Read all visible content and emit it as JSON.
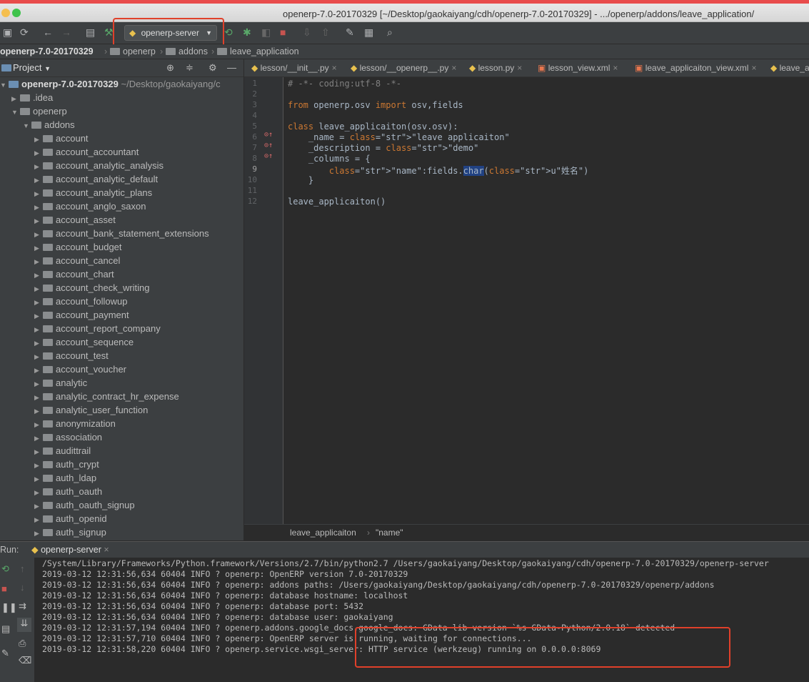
{
  "window": {
    "title": "openerp-7.0-20170329 [~/Desktop/gaokaiyang/cdh/openerp-7.0-20170329] - .../openerp/addons/leave_application/"
  },
  "toolbar": {
    "run_config": "openerp-server"
  },
  "breadcrumbs": [
    "openerp-7.0-20170329",
    "openerp",
    "addons",
    "leave_application"
  ],
  "project": {
    "title": "Project",
    "root": {
      "name": "openerp-7.0-20170329",
      "path": "~/Desktop/gaokaiyang/c"
    },
    "items": [
      {
        "label": ".idea",
        "level": 1,
        "open": false
      },
      {
        "label": "openerp",
        "level": 1,
        "open": true
      },
      {
        "label": "addons",
        "level": 2,
        "open": true
      },
      {
        "label": "account",
        "level": 3
      },
      {
        "label": "account_accountant",
        "level": 3
      },
      {
        "label": "account_analytic_analysis",
        "level": 3
      },
      {
        "label": "account_analytic_default",
        "level": 3
      },
      {
        "label": "account_analytic_plans",
        "level": 3
      },
      {
        "label": "account_anglo_saxon",
        "level": 3
      },
      {
        "label": "account_asset",
        "level": 3
      },
      {
        "label": "account_bank_statement_extensions",
        "level": 3
      },
      {
        "label": "account_budget",
        "level": 3
      },
      {
        "label": "account_cancel",
        "level": 3
      },
      {
        "label": "account_chart",
        "level": 3
      },
      {
        "label": "account_check_writing",
        "level": 3
      },
      {
        "label": "account_followup",
        "level": 3
      },
      {
        "label": "account_payment",
        "level": 3
      },
      {
        "label": "account_report_company",
        "level": 3
      },
      {
        "label": "account_sequence",
        "level": 3
      },
      {
        "label": "account_test",
        "level": 3
      },
      {
        "label": "account_voucher",
        "level": 3
      },
      {
        "label": "analytic",
        "level": 3
      },
      {
        "label": "analytic_contract_hr_expense",
        "level": 3
      },
      {
        "label": "analytic_user_function",
        "level": 3
      },
      {
        "label": "anonymization",
        "level": 3
      },
      {
        "label": "association",
        "level": 3
      },
      {
        "label": "audittrail",
        "level": 3
      },
      {
        "label": "auth_crypt",
        "level": 3
      },
      {
        "label": "auth_ldap",
        "level": 3
      },
      {
        "label": "auth_oauth",
        "level": 3
      },
      {
        "label": "auth_oauth_signup",
        "level": 3
      },
      {
        "label": "auth_openid",
        "level": 3
      },
      {
        "label": "auth_signup",
        "level": 3
      }
    ]
  },
  "tabs": [
    "lesson/__init__.py",
    "lesson/__openerp__.py",
    "lesson.py",
    "lesson_view.xml",
    "leave_applicaiton_view.xml",
    "leave_a"
  ],
  "editor": {
    "lines": [
      "# -*- coding:utf-8 -*-",
      "",
      "from openerp.osv import osv,fields",
      "",
      "class leave_applicaiton(osv.osv):",
      "    _name = \"leave applicaiton\"",
      "    _description = \"demo\"",
      "    _columns = {",
      "        \"name\":fields.char(u\"姓名\")",
      "    }",
      "",
      "leave_applicaiton()"
    ],
    "breadcrumb": [
      "leave_applicaiton",
      "\"name\""
    ]
  },
  "run": {
    "label": "Run:",
    "tab": "openerp-server",
    "console": [
      "/System/Library/Frameworks/Python.framework/Versions/2.7/bin/python2.7 /Users/gaokaiyang/Desktop/gaokaiyang/cdh/openerp-7.0-20170329/openerp-server",
      "2019-03-12 12:31:56,634 60404 INFO ? openerp: OpenERP version 7.0-20170329",
      "2019-03-12 12:31:56,634 60404 INFO ? openerp: addons paths: /Users/gaokaiyang/Desktop/gaokaiyang/cdh/openerp-7.0-20170329/openerp/addons",
      "2019-03-12 12:31:56,634 60404 INFO ? openerp: database hostname: localhost",
      "2019-03-12 12:31:56,634 60404 INFO ? openerp: database port: 5432",
      "2019-03-12 12:31:56,634 60404 INFO ? openerp: database user: gaokaiyang",
      "2019-03-12 12:31:57,194 60404 INFO ? openerp.addons.google_docs.google_docs: GData lib version `%s GData-Python/2.0.18` detected",
      "2019-03-12 12:31:57,710 60404 INFO ? openerp: OpenERP server is running, waiting for connections...",
      "2019-03-12 12:31:58,220 60404 INFO ? openerp.service.wsgi_server: HTTP service (werkzeug) running on 0.0.0.0:8069"
    ]
  },
  "colors": {
    "accent_red": "#e0402a",
    "keyword": "#cc7832",
    "string": "#6a8759"
  }
}
